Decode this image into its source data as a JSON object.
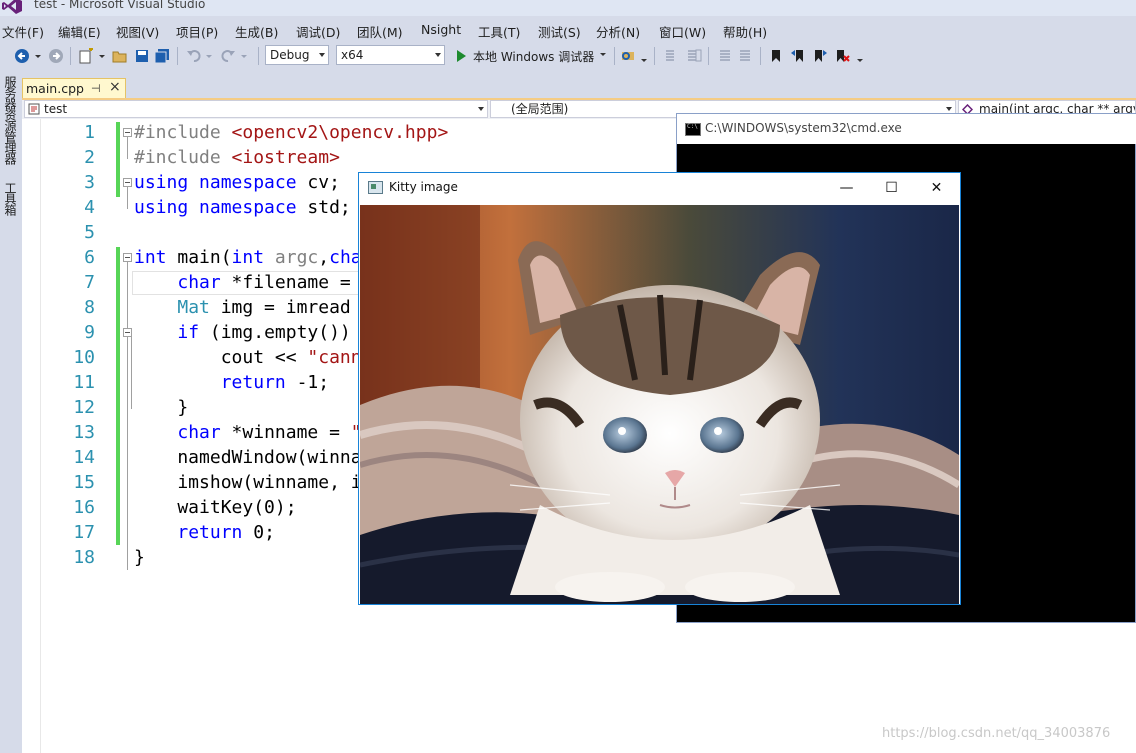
{
  "window": {
    "title": "test - Microsoft Visual Studio"
  },
  "menu": [
    "文件(F)",
    "编辑(E)",
    "视图(V)",
    "项目(P)",
    "生成(B)",
    "调试(D)",
    "团队(M)",
    "Nsight",
    "工具(T)",
    "测试(S)",
    "分析(N)",
    "窗口(W)",
    "帮助(H)"
  ],
  "toolbar": {
    "config": "Debug",
    "platform": "x64",
    "run_label": "本地 Windows 调试器"
  },
  "sidebar": {
    "server_explorer": "服务器资源管理器",
    "toolbox": "工具箱"
  },
  "tabs": [
    {
      "label": "main.cpp"
    }
  ],
  "navbar": {
    "project": "test",
    "scope": "(全局范围)",
    "member": "main(int argc, char ** argv)"
  },
  "editor": {
    "line_numbers": [
      "1",
      "2",
      "3",
      "4",
      "5",
      "6",
      "7",
      "8",
      "9",
      "10",
      "11",
      "12",
      "13",
      "14",
      "15",
      "16",
      "17",
      "18"
    ],
    "lines": [
      "#include <opencv2\\opencv.hpp>",
      "#include <iostream>",
      "using namespace cv;",
      "using namespace std;",
      "",
      "int main(int argc,char",
      "    char *filename =",
      "    Mat img = imread",
      "    if (img.empty())",
      "        cout << \"cann",
      "        return -1;",
      "    }",
      "    char *winname = \"",
      "    namedWindow(winna",
      "    imshow(winname, i",
      "    waitKey(0);",
      "    return 0;",
      "}"
    ]
  },
  "cmd_window": {
    "title": "C:\\WINDOWS\\system32\\cmd.exe"
  },
  "kitty_window": {
    "title": "Kitty image",
    "minimize": "—",
    "maximize": "☐",
    "close": "✕"
  },
  "watermark": "https://blog.csdn.net/qq_34003876",
  "colors": {
    "accent": "#1883d7",
    "chrome": "#d6dbe9",
    "tab_active": "#fff8cf",
    "change_bar": "#57d557"
  }
}
